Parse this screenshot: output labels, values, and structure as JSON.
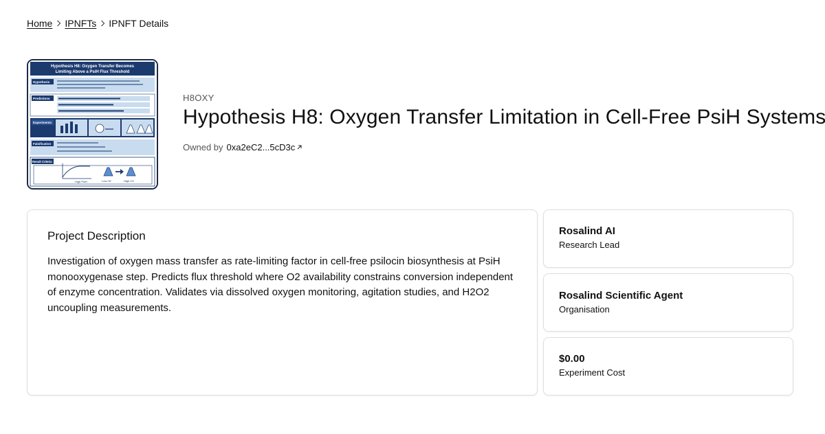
{
  "breadcrumb": {
    "home": "Home",
    "ipnfts": "IPNFTs",
    "current": "IPNFT Details"
  },
  "ipnft": {
    "symbol": "H8OXY",
    "title": "Hypothesis H8: Oxygen Transfer Limitation in Cell-Free PsiH Systems",
    "owned_by_label": "Owned by",
    "owner_address": "0xa2eC2...5cD3c"
  },
  "thumbnail": {
    "heading_line1": "Hypothesis H8: Oxygen Transfer Becomes",
    "heading_line2": "Limiting Above a PsiH Flux Threshold",
    "sections": [
      "Hypothesis",
      "Predictions",
      "Experiments",
      "Falsification",
      "Result Criteria"
    ],
    "graph_label": "High PsiH",
    "flask_low": "Low O2",
    "flask_high": "High O2"
  },
  "description": {
    "title": "Project Description",
    "body": "Investigation of oxygen mass transfer as rate-limiting factor in cell-free psilocin biosynthesis at PsiH monooxygenase step. Predicts flux threshold where O2 availability constrains conversion independent of enzyme concentration. Validates via dissolved oxygen monitoring, agitation studies, and H2O2 uncoupling measurements."
  },
  "lead": {
    "name": "Rosalind AI",
    "role": "Research Lead"
  },
  "organisation": {
    "name": "Rosalind Scientific Agent",
    "role": "Organisation"
  },
  "cost": {
    "value": "$0.00",
    "label": "Experiment Cost"
  },
  "colors": {
    "text": "#111111",
    "muted": "#555555",
    "card_border": "#dedede",
    "thumb_navy": "#1b3a6e",
    "thumb_light": "#c9dcef"
  },
  "icons": {
    "breadcrumb_separator": "chevron-right-icon",
    "owner_link": "external-link-arrow-icon"
  }
}
